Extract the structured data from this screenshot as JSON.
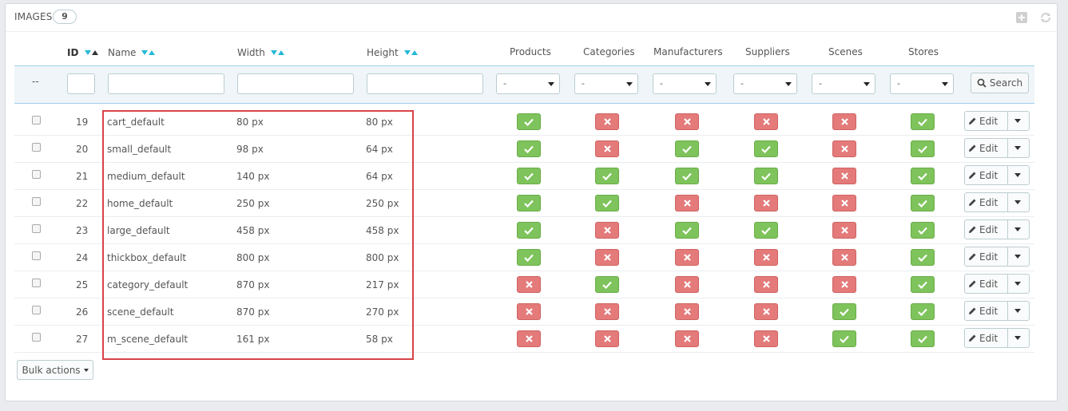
{
  "panel": {
    "title": "Images",
    "count": "9"
  },
  "columns": {
    "id": "ID",
    "name": "Name",
    "width": "Width",
    "height": "Height",
    "products": "Products",
    "categories": "Categories",
    "manufacturers": "Manufacturers",
    "suppliers": "Suppliers",
    "scenes": "Scenes",
    "stores": "Stores"
  },
  "filters": {
    "checkbox_placeholder": "--",
    "select_value": "-",
    "search_label": "Search"
  },
  "rows": [
    {
      "id": "19",
      "name": "cart_default",
      "width": "80 px",
      "height": "80 px",
      "products": true,
      "categories": false,
      "manufacturers": false,
      "suppliers": false,
      "scenes": false,
      "stores": true
    },
    {
      "id": "20",
      "name": "small_default",
      "width": "98 px",
      "height": "64 px",
      "products": true,
      "categories": false,
      "manufacturers": true,
      "suppliers": true,
      "scenes": false,
      "stores": true
    },
    {
      "id": "21",
      "name": "medium_default",
      "width": "140 px",
      "height": "64 px",
      "products": true,
      "categories": true,
      "manufacturers": true,
      "suppliers": true,
      "scenes": false,
      "stores": true
    },
    {
      "id": "22",
      "name": "home_default",
      "width": "250 px",
      "height": "250 px",
      "products": true,
      "categories": true,
      "manufacturers": false,
      "suppliers": false,
      "scenes": false,
      "stores": true
    },
    {
      "id": "23",
      "name": "large_default",
      "width": "458 px",
      "height": "458 px",
      "products": true,
      "categories": false,
      "manufacturers": true,
      "suppliers": true,
      "scenes": false,
      "stores": true
    },
    {
      "id": "24",
      "name": "thickbox_default",
      "width": "800 px",
      "height": "800 px",
      "products": true,
      "categories": false,
      "manufacturers": false,
      "suppliers": false,
      "scenes": false,
      "stores": true
    },
    {
      "id": "25",
      "name": "category_default",
      "width": "870 px",
      "height": "217 px",
      "products": false,
      "categories": true,
      "manufacturers": false,
      "suppliers": false,
      "scenes": false,
      "stores": true
    },
    {
      "id": "26",
      "name": "scene_default",
      "width": "870 px",
      "height": "270 px",
      "products": false,
      "categories": false,
      "manufacturers": false,
      "suppliers": false,
      "scenes": true,
      "stores": true
    },
    {
      "id": "27",
      "name": "m_scene_default",
      "width": "161 px",
      "height": "58 px",
      "products": false,
      "categories": false,
      "manufacturers": false,
      "suppliers": false,
      "scenes": true,
      "stores": true
    }
  ],
  "row_actions": {
    "edit_label": "Edit"
  },
  "bulk_actions_label": "Bulk actions",
  "colors": {
    "enabled": "#7ec35b",
    "disabled": "#e47a7a",
    "highlight": "#d9434a",
    "sort_arrow": "#25b9d7"
  }
}
